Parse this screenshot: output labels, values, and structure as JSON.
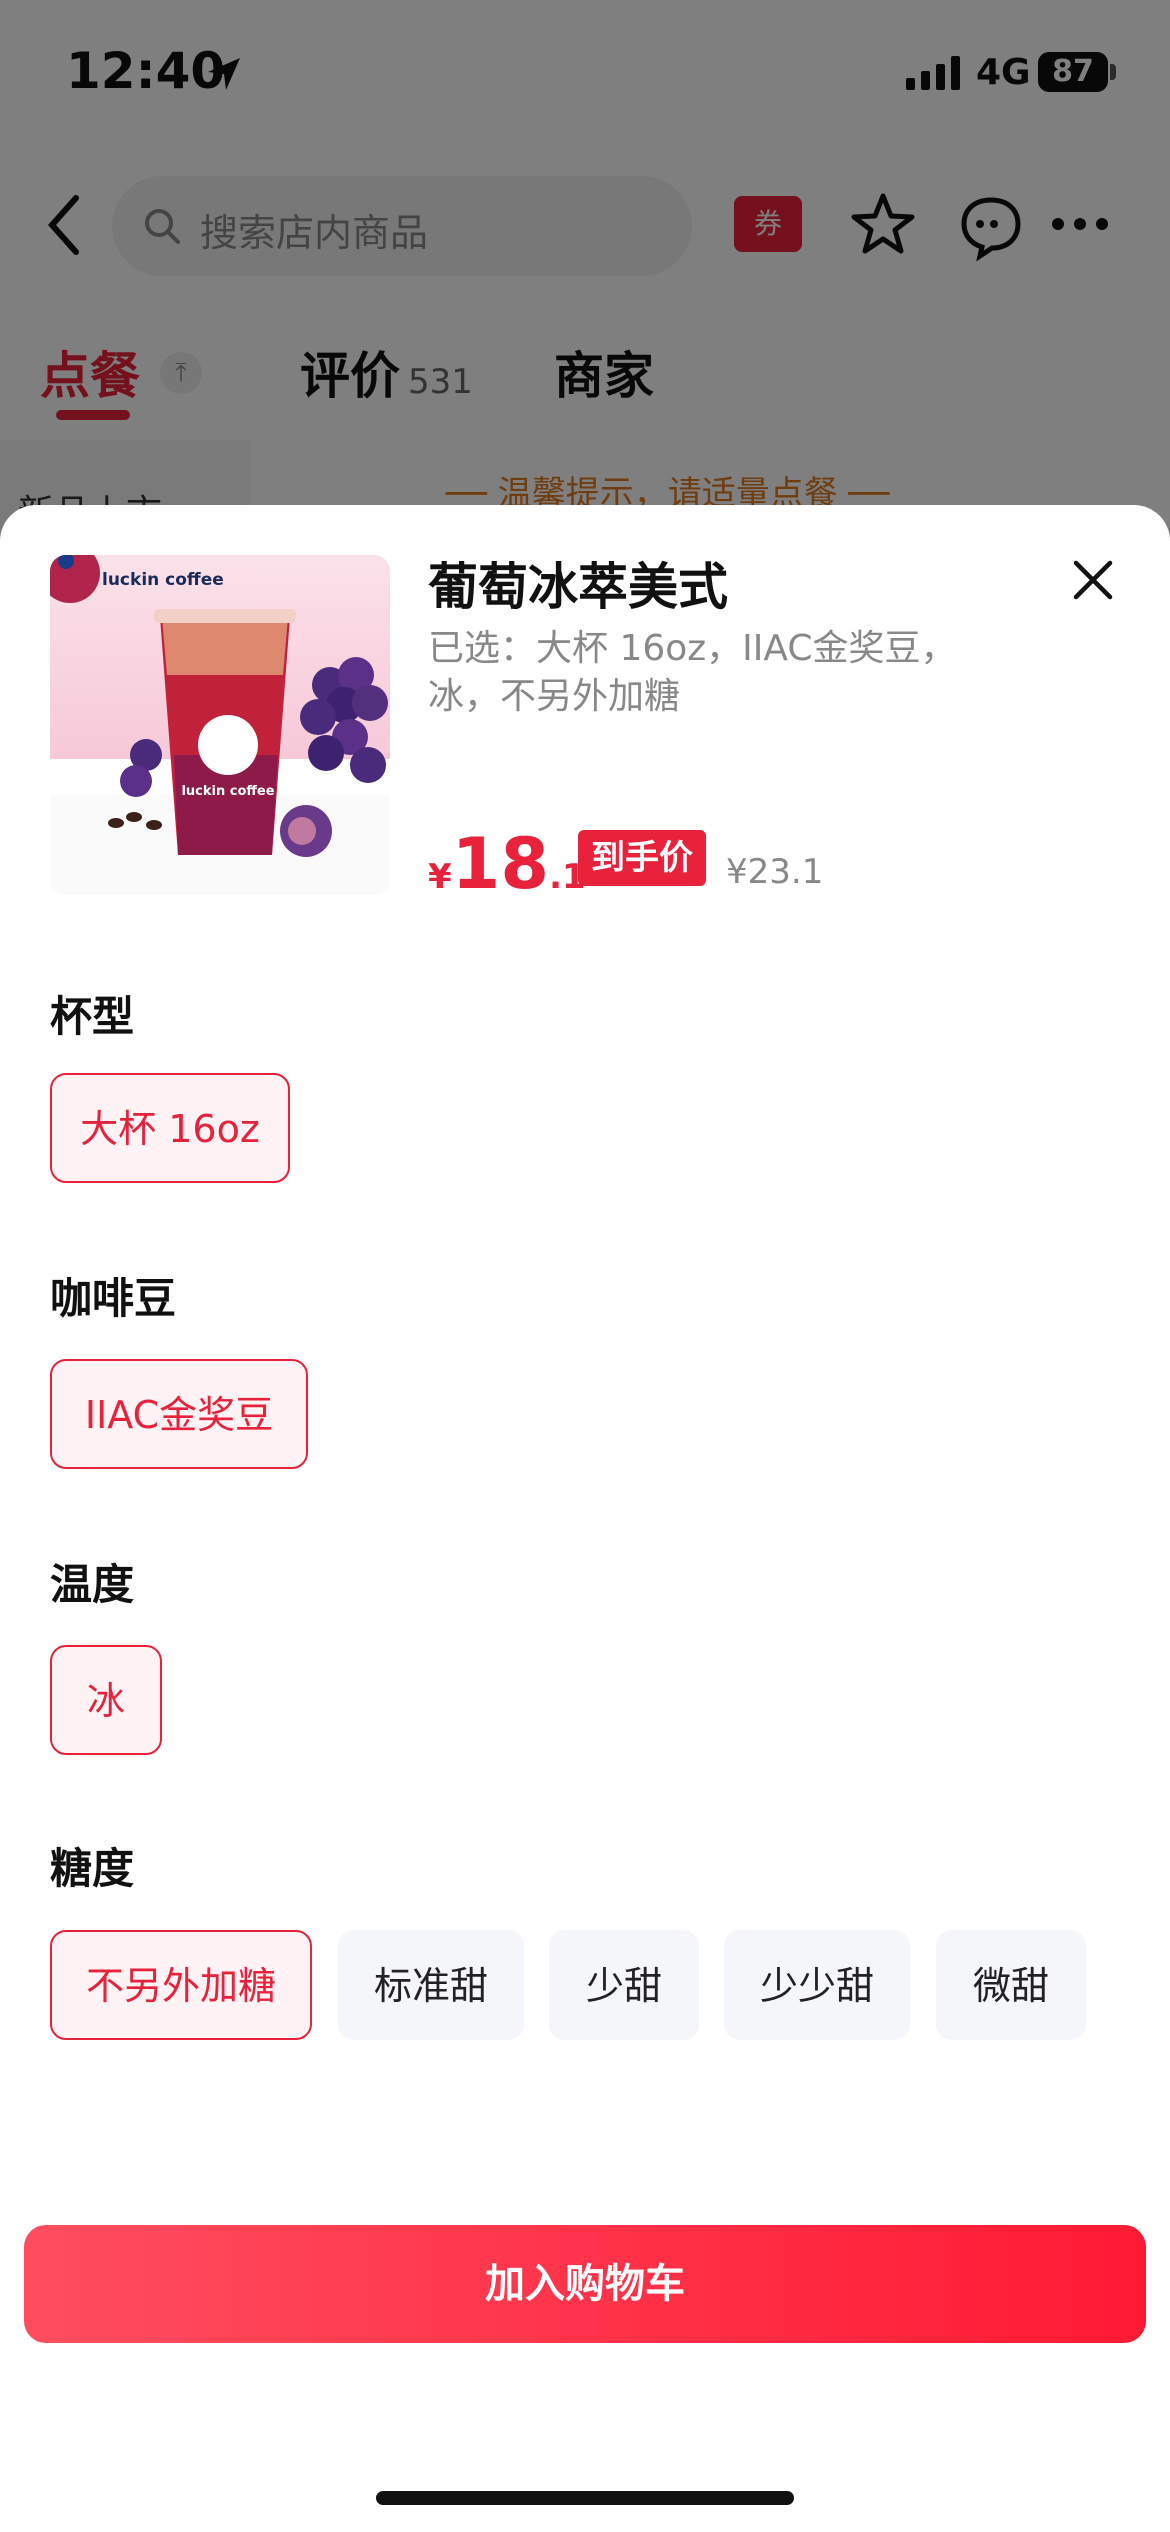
{
  "status_bar": {
    "time": "12:40",
    "network": "4G",
    "battery": "87"
  },
  "header": {
    "search_placeholder": "搜索店内商品",
    "coupon_label": "券"
  },
  "tabs": [
    {
      "label": "点餐"
    },
    {
      "label": "评价",
      "count": "531"
    },
    {
      "label": "商家"
    }
  ],
  "background": {
    "left_category": "新品上市",
    "tip": "── 温馨提示，请适量点餐 ──"
  },
  "product": {
    "title": "葡萄冰萃美式",
    "selected": "已选：大杯 16oz，IIAC金奖豆，冰，不另外加糖",
    "price_currency": "¥",
    "price_int": "18",
    "price_dec": ".1",
    "price_tag": "到手价",
    "original_price": "¥23.1",
    "brand_text": "luckin coffee"
  },
  "groups": [
    {
      "title": "杯型",
      "options": [
        {
          "label": "大杯 16oz",
          "selected": true
        }
      ]
    },
    {
      "title": "咖啡豆",
      "options": [
        {
          "label": "IIAC金奖豆",
          "selected": true
        }
      ]
    },
    {
      "title": "温度",
      "options": [
        {
          "label": "冰",
          "selected": true
        }
      ]
    },
    {
      "title": "糖度",
      "options": [
        {
          "label": "不另外加糖",
          "selected": true
        },
        {
          "label": "标准甜",
          "selected": false
        },
        {
          "label": "少甜",
          "selected": false
        },
        {
          "label": "少少甜",
          "selected": false
        },
        {
          "label": "微甜",
          "selected": false
        }
      ]
    }
  ],
  "cart_button": "加入购物车",
  "colors": {
    "accent": "#e8223a",
    "selected_bg": "#fff3f5",
    "option_bg": "#f5f6fa"
  }
}
